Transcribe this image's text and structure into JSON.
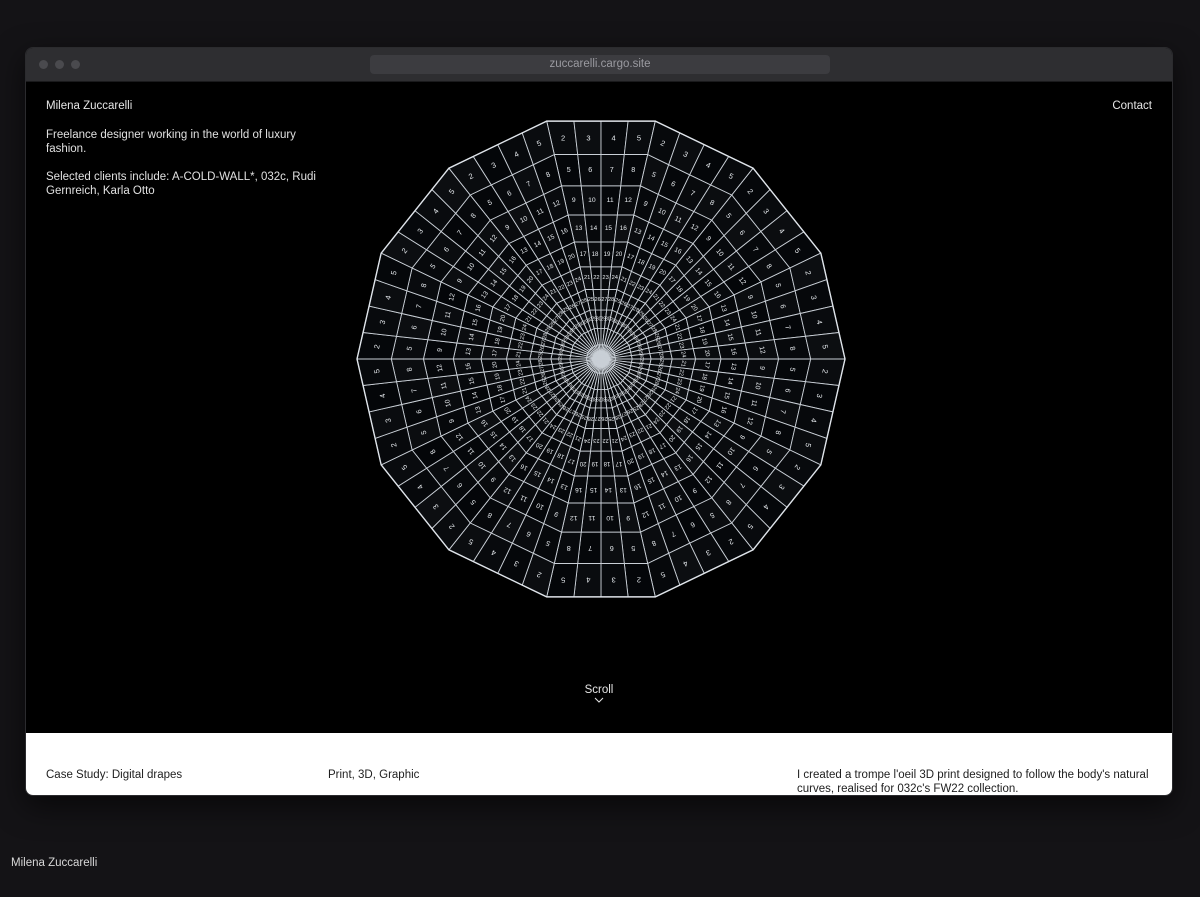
{
  "browser": {
    "url": "zuccarelli.cargo.site"
  },
  "site": {
    "name": "Milena Zuccarelli",
    "contact_label": "Contact",
    "intro": "Freelance designer working in the world of luxury fashion.",
    "clients": "Selected clients include: A-COLD-WALL*, 032c, Rudi Gernreich, Karla Otto",
    "scroll_label": "Scroll"
  },
  "graphic": {
    "sides": 14,
    "rings": 10,
    "cells_per_side": 4,
    "line_color": "#c9cfd6",
    "cell_number_rings": [
      [
        2,
        3,
        4,
        5
      ],
      [
        5,
        6,
        7,
        8
      ],
      [
        9,
        10,
        11,
        12
      ],
      [
        13,
        14,
        15,
        16
      ],
      [
        17,
        18,
        19,
        20
      ],
      [
        21,
        22,
        23,
        24
      ],
      [
        25,
        26,
        27,
        28
      ],
      [
        29,
        30
      ]
    ]
  },
  "case_study": {
    "title": "Case Study: Digital drapes",
    "tags": "Print, 3D, Graphic",
    "description": "I created a trompe l'oeil 3D print designed to follow the body's natural curves, realised for 032c's FW22 collection."
  },
  "footer": {
    "name": "Milena Zuccarelli"
  }
}
